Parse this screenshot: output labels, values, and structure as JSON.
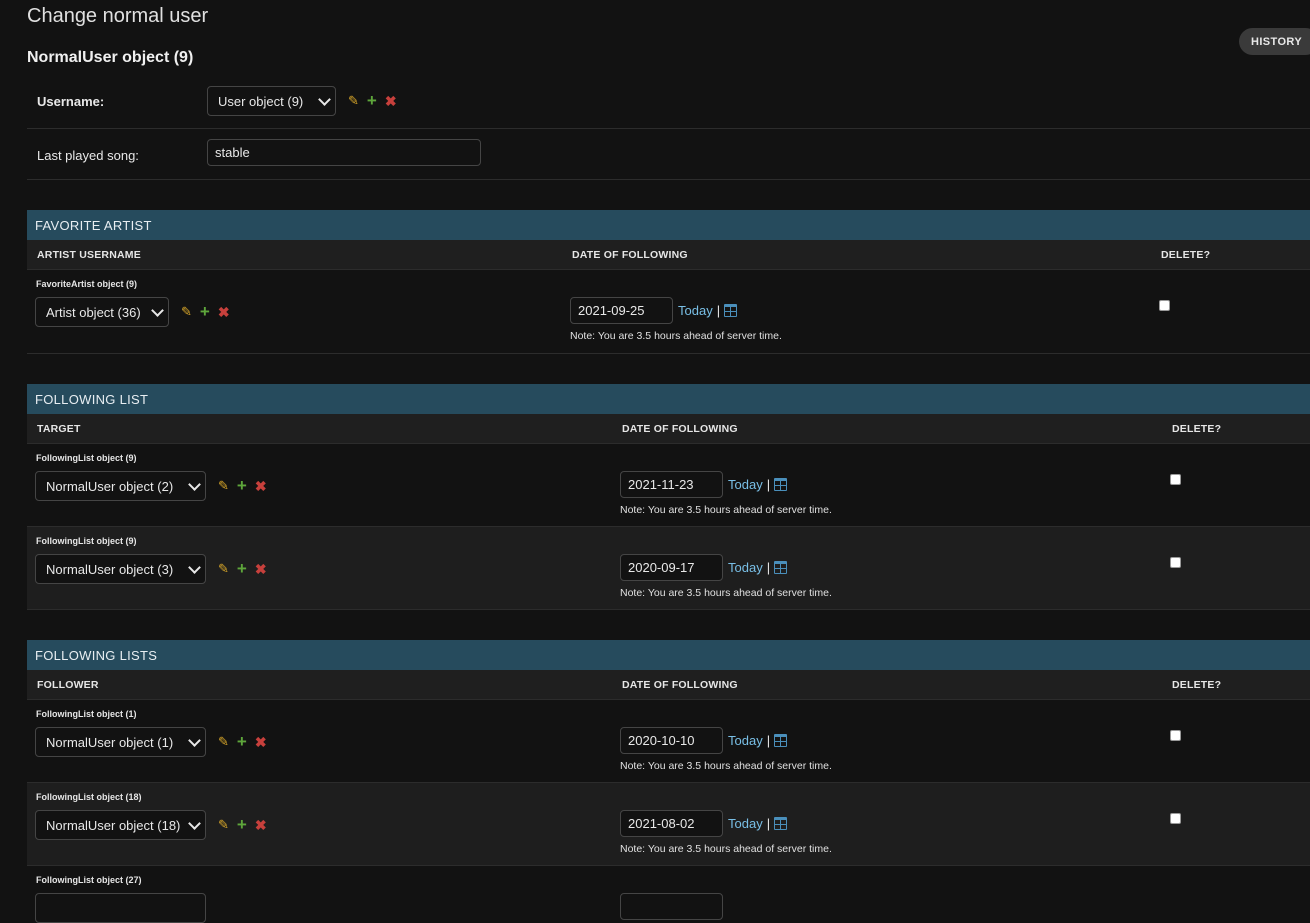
{
  "page": {
    "title": "Change normal user",
    "history_label": "HISTORY",
    "object_title": "NormalUser object (9)"
  },
  "fields": {
    "username_label": "Username:",
    "username_value": "User object (9)",
    "last_song_label": "Last played song:",
    "last_song_value": "stable"
  },
  "icons": {
    "edit": "pencil-icon",
    "add": "plus-icon",
    "delete": "x-icon",
    "calendar": "calendar-icon"
  },
  "common": {
    "today": "Today",
    "separator": "|",
    "note": "Note: You are 3.5 hours ahead of server time."
  },
  "favorite_artist": {
    "title": "FAVORITE ARTIST",
    "columns": [
      "ARTIST USERNAME",
      "DATE OF FOLLOWING",
      "DELETE?"
    ],
    "rows": [
      {
        "label": "FavoriteArtist object (9)",
        "select": "Artist object (36)",
        "date": "2021-09-25",
        "delete": false
      }
    ]
  },
  "following_list": {
    "title": "FOLLOWING LIST",
    "columns": [
      "TARGET",
      "DATE OF FOLLOWING",
      "DELETE?"
    ],
    "rows": [
      {
        "label": "FollowingList object (9)",
        "select": "NormalUser object (2)",
        "date": "2021-11-23",
        "delete": false
      },
      {
        "label": "FollowingList object (9)",
        "select": "NormalUser object (3)",
        "date": "2020-09-17",
        "delete": false
      }
    ]
  },
  "following_lists": {
    "title": "FOLLOWING LISTS",
    "columns": [
      "FOLLOWER",
      "DATE OF FOLLOWING",
      "DELETE?"
    ],
    "rows": [
      {
        "label": "FollowingList object (1)",
        "select": "NormalUser object (1)",
        "date": "2020-10-10",
        "delete": false
      },
      {
        "label": "FollowingList object (18)",
        "select": "NormalUser object (18)",
        "date": "2021-08-02",
        "delete": false
      },
      {
        "label": "FollowingList object (27)",
        "select": "",
        "date": "",
        "delete": false
      }
    ]
  }
}
